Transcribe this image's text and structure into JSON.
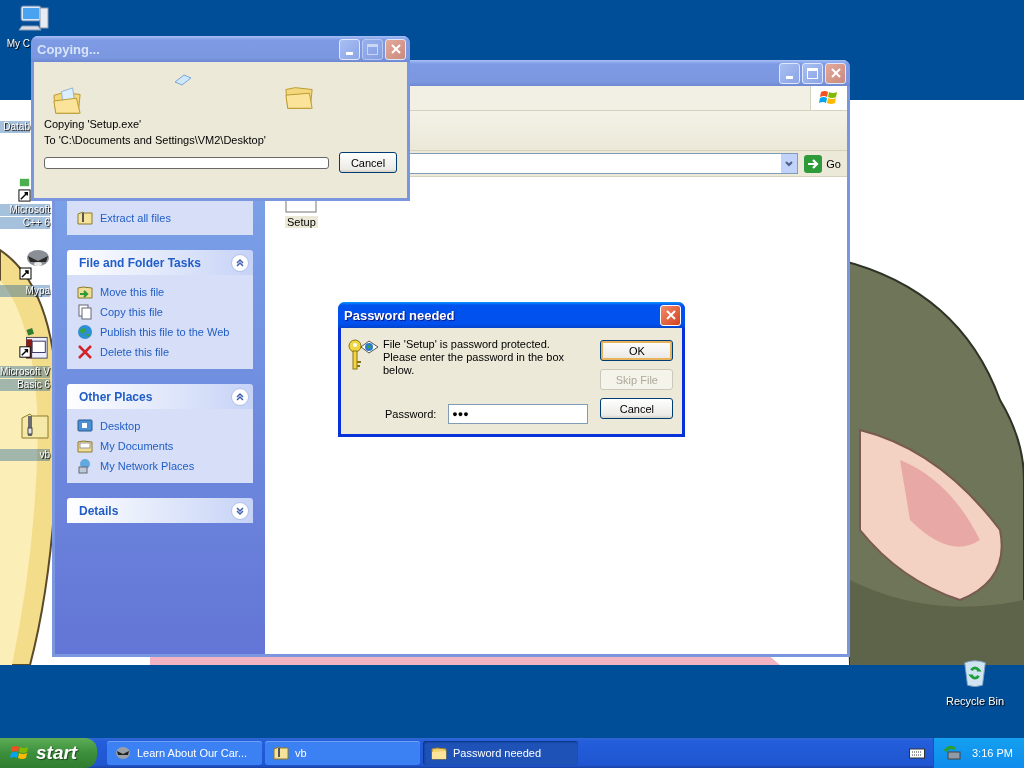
{
  "desktop_icons": [
    {
      "label_lines": [
        "My C"
      ]
    },
    {
      "label_lines": [
        "Datab"
      ]
    },
    {
      "label_lines": [
        "Microsoft",
        "C++ 6"
      ]
    },
    {
      "label_lines": [
        "Mypa"
      ]
    },
    {
      "label_lines": [
        "Microsoft V",
        "Basic 6"
      ]
    },
    {
      "label_lines": [
        "vb"
      ]
    }
  ],
  "recycle_bin": {
    "label": "Recycle Bin"
  },
  "explorer": {
    "active": false,
    "go": "Go",
    "sidebar": [
      {
        "items": [
          {
            "label": "Extract all files"
          }
        ]
      },
      {
        "title": "File and Folder Tasks",
        "expanded": true,
        "items": [
          {
            "label": "Move this file"
          },
          {
            "label": "Copy this file"
          },
          {
            "label": "Publish this file to the Web"
          },
          {
            "label": "Delete this file"
          }
        ]
      },
      {
        "title": "Other Places",
        "expanded": true,
        "items": [
          {
            "label": "Desktop"
          },
          {
            "label": "My Documents"
          },
          {
            "label": "My Network Places"
          }
        ]
      },
      {
        "title": "Details",
        "expanded": false
      }
    ],
    "files": [
      {
        "label": "Setup"
      }
    ]
  },
  "copy_dialog": {
    "title": "Copying...",
    "active": false,
    "lines": [
      "Copying 'Setup.exe'",
      "To 'C:\\Documents and Settings\\VM2\\Desktop'"
    ],
    "progress": {
      "level": 0
    },
    "cancel": "Cancel"
  },
  "password_dialog": {
    "title": "Password needed",
    "active": true,
    "message": "File 'Setup' is password protected.  Please enter the password in the box below.",
    "password_label": "Password:",
    "password_value": "●●●",
    "buttons": [
      {
        "label": "OK",
        "default": true,
        "disabled": false
      },
      {
        "label": "Skip File",
        "default": false,
        "disabled": true
      },
      {
        "label": "Cancel",
        "default": false,
        "disabled": false
      }
    ]
  },
  "taskbar": {
    "start": "start",
    "tasks": [
      {
        "label": "Learn About Our Car...",
        "selected": false
      },
      {
        "label": "vb",
        "selected": false
      },
      {
        "label": "Password needed",
        "selected": true
      }
    ],
    "clock": "3:16 PM"
  }
}
